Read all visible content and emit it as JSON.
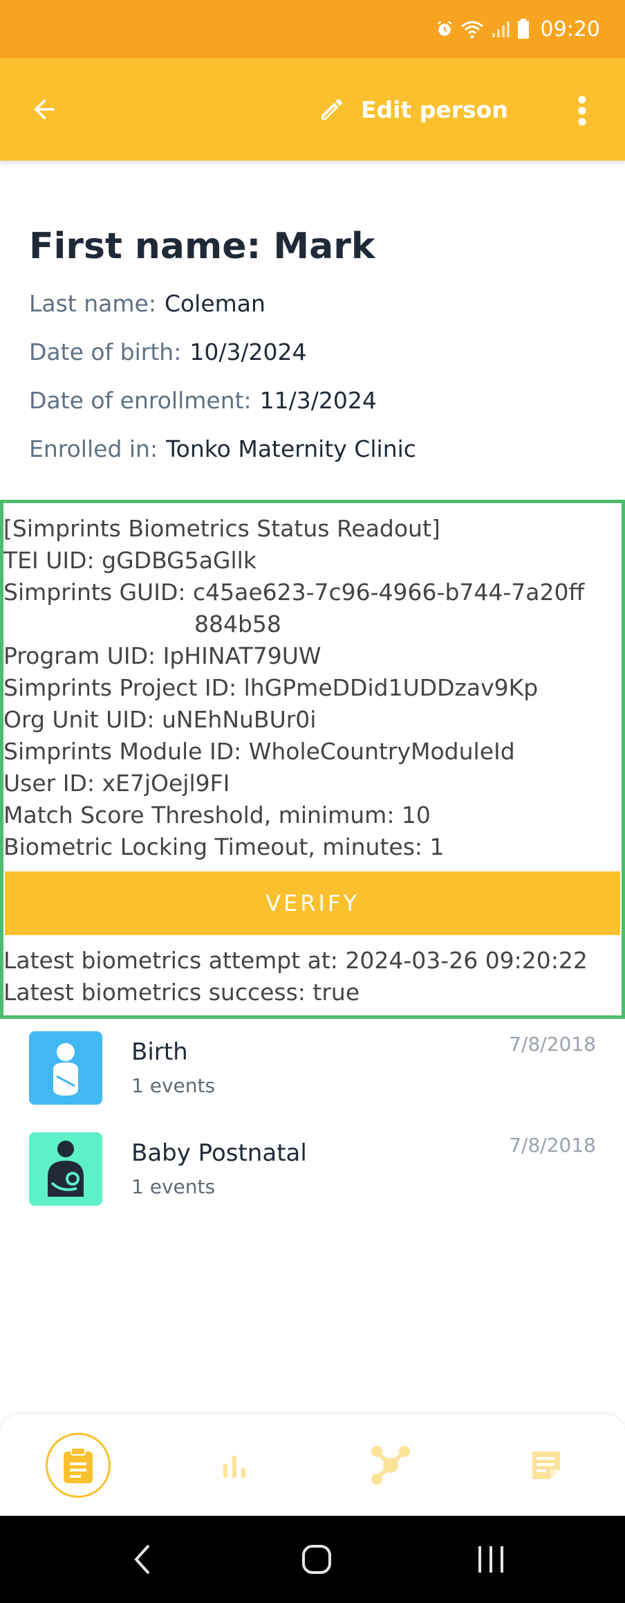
{
  "status_bar": {
    "time": "09:20"
  },
  "app_bar": {
    "edit_label": "Edit person"
  },
  "person": {
    "title": "First name: Mark",
    "rows": [
      {
        "label": "Last name:",
        "value": "Coleman"
      },
      {
        "label": "Date of birth:",
        "value": "10/3/2024"
      },
      {
        "label": "Date of enrollment:",
        "value": "11/3/2024"
      },
      {
        "label": "Enrolled in:",
        "value": "Tonko Maternity Clinic"
      }
    ]
  },
  "readout": {
    "header": "[Simprints Biometrics Status Readout]",
    "tei_uid": "TEI UID: gGDBG5aGllk",
    "guid_line1": "Simprints GUID: c45ae623-7c96-4966-b744-7a20ff",
    "guid_line2": "884b58",
    "program_uid": "Program UID: IpHINAT79UW",
    "project_id": "Simprints Project ID: lhGPmeDDid1UDDzav9Kp",
    "org_unit": "Org Unit UID: uNEhNuBUr0i",
    "module_id": "Simprints Module ID: WholeCountryModuleId",
    "user_id": "User ID: xE7jOejl9FI",
    "match_threshold": "Match Score Threshold, minimum:  10",
    "locking_timeout": "Biometric Locking Timeout, minutes:  1",
    "verify_label": "VERIFY",
    "latest_attempt": "Latest biometrics attempt at: 2024-03-26 09:20:22",
    "latest_success": "Latest biometrics success: true"
  },
  "stages": [
    {
      "name": "Birth",
      "count": "1 events",
      "date": "7/8/2018",
      "color": "#42b8f2",
      "icon": "baby-icon"
    },
    {
      "name": "Baby Postnatal",
      "count": "1 events",
      "date": "7/8/2018",
      "color": "#5ef0c8",
      "icon": "mother-child-icon"
    }
  ],
  "bottom_nav": [
    "clipboard-icon",
    "bar-chart-icon",
    "relationships-icon",
    "notes-icon"
  ],
  "colors": {
    "status_bar": "#f7a521",
    "app_bar": "#fbc02d",
    "readout_border": "#4cbd6e"
  }
}
